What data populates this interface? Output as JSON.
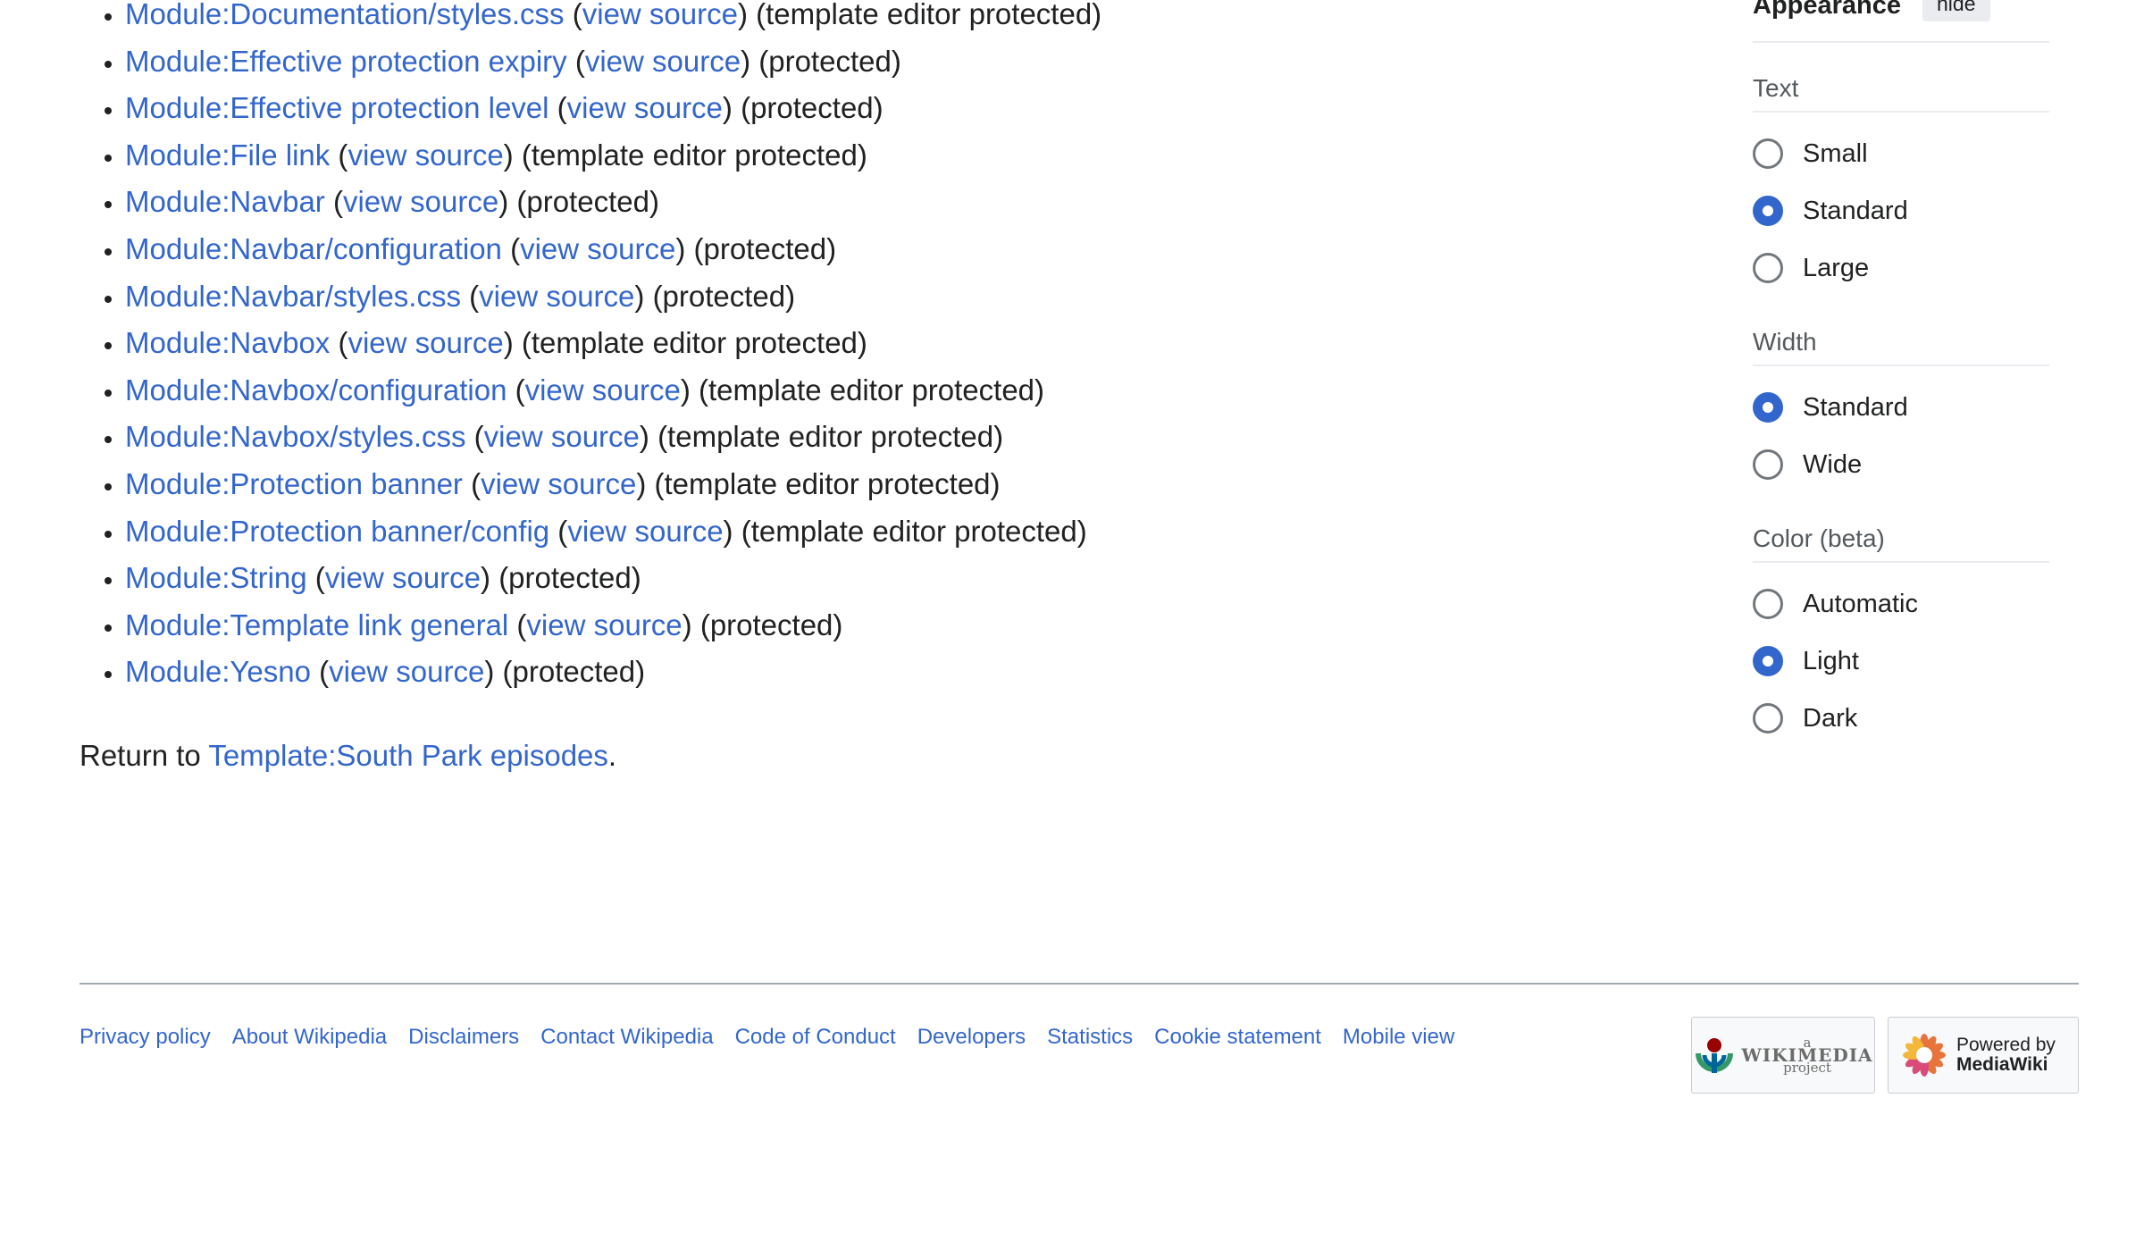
{
  "modules": [
    {
      "link": "Module:Documentation/styles.css",
      "view": "view source",
      "status": "(template editor protected)"
    },
    {
      "link": "Module:Effective protection expiry",
      "view": "view source",
      "status": "(protected)"
    },
    {
      "link": "Module:Effective protection level",
      "view": "view source",
      "status": "(protected)"
    },
    {
      "link": "Module:File link",
      "view": "view source",
      "status": "(template editor protected)"
    },
    {
      "link": "Module:Navbar",
      "view": "view source",
      "status": "(protected)"
    },
    {
      "link": "Module:Navbar/configuration",
      "view": "view source",
      "status": "(protected)"
    },
    {
      "link": "Module:Navbar/styles.css",
      "view": "view source",
      "status": "(protected)"
    },
    {
      "link": "Module:Navbox",
      "view": "view source",
      "status": "(template editor protected)"
    },
    {
      "link": "Module:Navbox/configuration",
      "view": "view source",
      "status": "(template editor protected)"
    },
    {
      "link": "Module:Navbox/styles.css",
      "view": "view source",
      "status": "(template editor protected)"
    },
    {
      "link": "Module:Protection banner",
      "view": "view source",
      "status": "(template editor protected)"
    },
    {
      "link": "Module:Protection banner/config",
      "view": "view source",
      "status": "(template editor protected)"
    },
    {
      "link": "Module:String",
      "view": "view source",
      "status": "(protected)"
    },
    {
      "link": "Module:Template link general",
      "view": "view source",
      "status": "(protected)"
    },
    {
      "link": "Module:Yesno",
      "view": "view source",
      "status": "(protected)"
    }
  ],
  "return": {
    "prefix": "Return to ",
    "link": "Template:South Park episodes",
    "suffix": "."
  },
  "footer": {
    "links": [
      "Privacy policy",
      "About Wikipedia",
      "Disclaimers",
      "Contact Wikipedia",
      "Code of Conduct",
      "Developers",
      "Statistics",
      "Cookie statement",
      "Mobile view"
    ],
    "wikimedia_badge": {
      "a": "a",
      "name": "WIKIMEDIA",
      "project": "project"
    },
    "mediawiki_badge": {
      "line1": "Powered by",
      "line2": "MediaWiki"
    }
  },
  "appearance": {
    "title": "Appearance",
    "hide_label": "hide",
    "sections": [
      {
        "title": "Text",
        "options": [
          {
            "label": "Small",
            "selected": false
          },
          {
            "label": "Standard",
            "selected": true
          },
          {
            "label": "Large",
            "selected": false
          }
        ]
      },
      {
        "title": "Width",
        "options": [
          {
            "label": "Standard",
            "selected": true
          },
          {
            "label": "Wide",
            "selected": false
          }
        ]
      },
      {
        "title": "Color (beta)",
        "options": [
          {
            "label": "Automatic",
            "selected": false
          },
          {
            "label": "Light",
            "selected": true
          },
          {
            "label": "Dark",
            "selected": false
          }
        ]
      }
    ]
  },
  "colors": {
    "link": "#3366cc",
    "text": "#202122",
    "radio_selected": "#3366cc"
  }
}
